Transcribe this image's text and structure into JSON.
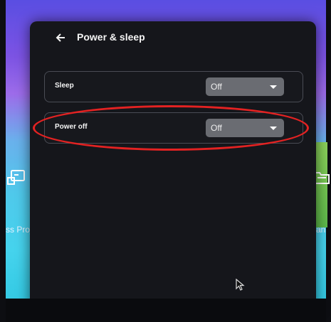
{
  "dialog": {
    "title": "Power & sleep",
    "back_icon": "arrow-left-icon"
  },
  "settings": [
    {
      "label": "Sleep",
      "value": "Off"
    },
    {
      "label": "Power off",
      "value": "Off"
    }
  ],
  "desktop": {
    "left_label": "ss Proj",
    "right_label": "e Man",
    "left_icon": "screen-mirror-icon",
    "right_icon": "folder-icon"
  },
  "annotation_color": "#e32222"
}
